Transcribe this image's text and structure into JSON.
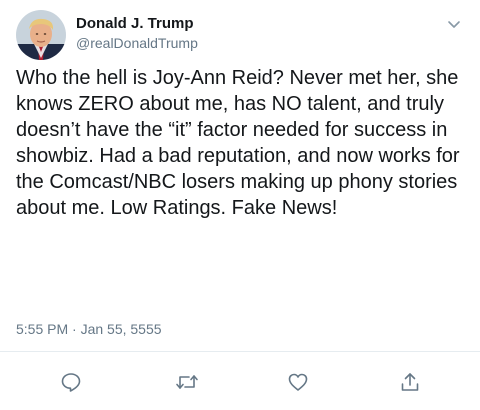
{
  "tweet": {
    "display_name": "Donald J. Trump",
    "handle": "@realDonaldTrump",
    "text": "Who the hell is Joy-Ann Reid? Never met her, she knows ZERO about me, has NO talent, and truly doesn’t have the “it” factor needed for success in showbiz. Had a bad reputation, and now works for the Comcast/NBC losers making up phony stories about me. Low Ratings. Fake News!",
    "timestamp": "5:55 PM · Jan 55, 5555"
  },
  "icons": {
    "menu": "chevron-down-icon",
    "reply": "reply-icon",
    "retweet": "retweet-icon",
    "like": "heart-icon",
    "share": "share-icon"
  },
  "colors": {
    "text": "#14171a",
    "secondary": "#657786",
    "divider": "#e6ecf0"
  }
}
